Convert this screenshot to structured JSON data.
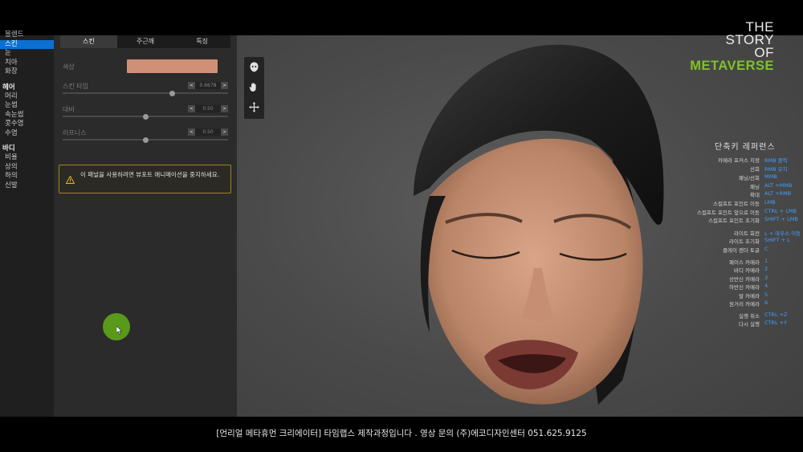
{
  "caption": "[언리얼 메타휴먼 크리에이터] 타임랩스 제작과정입니다 . 영상 문의 (주)에코디자인센터 051.625.9125",
  "left_nav": {
    "face_items": [
      "블렌드",
      "스킨",
      "눈",
      "치아",
      "화장"
    ],
    "hair_header": "헤어",
    "hair_items": [
      "머리",
      "눈썹",
      "속눈썹",
      "콧수염",
      "수염"
    ],
    "body_header": "바디",
    "body_items": [
      "비율",
      "상의",
      "하의",
      "신발"
    ]
  },
  "tabs": [
    "스킨",
    "주근깨",
    "특징"
  ],
  "skin": {
    "color_label": "색상",
    "color_value": "#d09078",
    "tone_label": "스킨 타입",
    "tone_value": "0.6678",
    "tone_fraction": 0.6678,
    "contrast_label": "대비",
    "contrast_value": "0.50",
    "contrast_fraction": 0.5,
    "roughness_label": "러프니스",
    "roughness_value": "0.50",
    "roughness_fraction": 0.5,
    "dec": "<",
    "inc": ">"
  },
  "warning_text": "이 패널을 사용하려면 뷰포트 애니메이션을 중지하세요.",
  "logo": [
    "THE",
    "STORY",
    "OF",
    "METAVERSE"
  ],
  "shortcuts": {
    "title": "단축키 레퍼런스",
    "rows": [
      {
        "action": "카메라 포커스 지정",
        "key": "RMB 클릭"
      },
      {
        "action": "선회",
        "key": "RMB 유지"
      },
      {
        "action": "패닝/선회",
        "key": "MMB"
      },
      {
        "action": "패닝",
        "key": "ALT +MMB"
      },
      {
        "action": "확대",
        "key": "ALT +RMB"
      },
      {
        "action": "스컬프트 포인트 이동",
        "key": "LMB"
      },
      {
        "action": "스컬프트 포인트 앞으로 이동",
        "key": "CTRL + LMB"
      },
      {
        "action": "스컬프트 포인트 초기화",
        "key": "SHIFT + LMB"
      },
      {
        "action": "라이트 회전",
        "key": "L + 마우스 이동"
      },
      {
        "action": "라이트 초기화",
        "key": "SHIFT + L"
      },
      {
        "action": "클레이 렌더 토글",
        "key": "C"
      },
      {
        "action": "페이스 카메라",
        "key": "1"
      },
      {
        "action": "바디 카메라",
        "key": "2"
      },
      {
        "action": "상반신 카메라",
        "key": "3"
      },
      {
        "action": "하반신 카메라",
        "key": "4"
      },
      {
        "action": "발 카메라",
        "key": "5"
      },
      {
        "action": "원거리 카메라",
        "key": "6"
      },
      {
        "action": "실행 취소",
        "key": "CTRL +Z"
      },
      {
        "action": "다시 실행",
        "key": "CTRL +Y"
      }
    ]
  },
  "icons": {
    "viewport_tools": [
      "head-view-icon",
      "hand-pan-icon",
      "move-icon"
    ],
    "warning": "warning-icon"
  }
}
